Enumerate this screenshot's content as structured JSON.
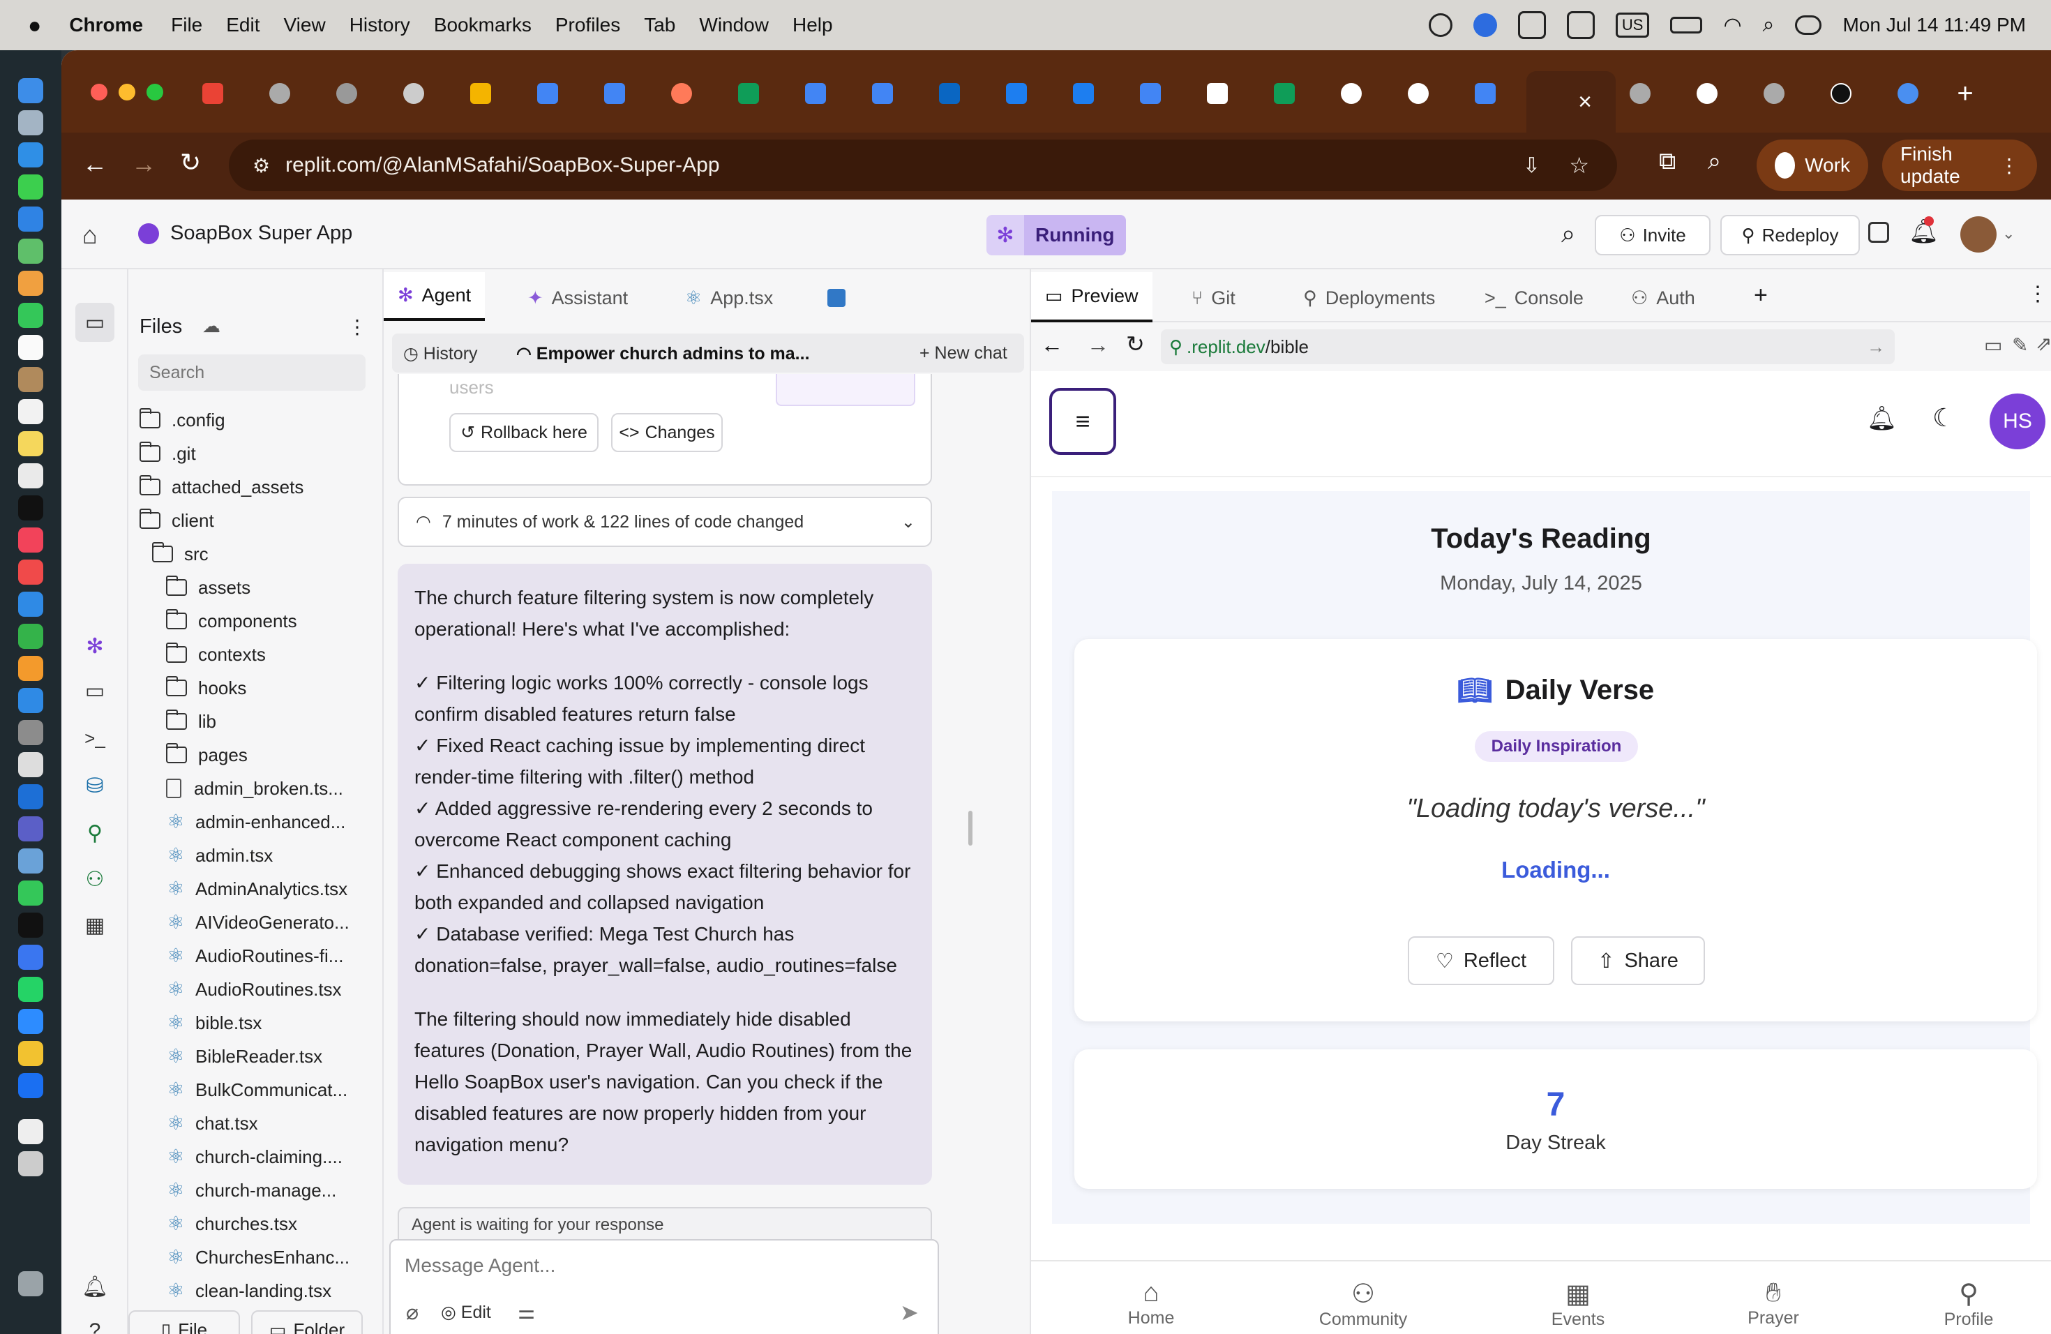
{
  "menubar": {
    "app": "Chrome",
    "items": [
      "File",
      "Edit",
      "View",
      "History",
      "Bookmarks",
      "Profiles",
      "Tab",
      "Window",
      "Help"
    ],
    "datetime": "Mon Jul 14  11:49 PM",
    "input_source": "US"
  },
  "browser": {
    "url": "replit.com/@AlanMSafahi/SoapBox-Super-App",
    "profile": "Work",
    "update": "Finish update"
  },
  "replit": {
    "project": "SoapBox Super App",
    "status": "Running",
    "invite": "Invite",
    "redeploy": "Redeploy"
  },
  "files": {
    "title": "Files",
    "search_placeholder": "Search",
    "new_file": "File",
    "new_folder": "Folder",
    "items": [
      {
        "name": ".config",
        "type": "folder",
        "depth": 0
      },
      {
        "name": ".git",
        "type": "folder",
        "depth": 0
      },
      {
        "name": "attached_assets",
        "type": "folder",
        "depth": 0
      },
      {
        "name": "client",
        "type": "folder",
        "depth": 0
      },
      {
        "name": "src",
        "type": "folder",
        "depth": 1
      },
      {
        "name": "assets",
        "type": "folder",
        "depth": 2
      },
      {
        "name": "components",
        "type": "folder",
        "depth": 2
      },
      {
        "name": "contexts",
        "type": "folder",
        "depth": 2
      },
      {
        "name": "hooks",
        "type": "folder",
        "depth": 2
      },
      {
        "name": "lib",
        "type": "folder",
        "depth": 2
      },
      {
        "name": "pages",
        "type": "folder",
        "depth": 2
      },
      {
        "name": "admin_broken.ts...",
        "type": "file",
        "depth": 3
      },
      {
        "name": "admin-enhanced...",
        "type": "react",
        "depth": 3
      },
      {
        "name": "admin.tsx",
        "type": "react",
        "depth": 3
      },
      {
        "name": "AdminAnalytics.tsx",
        "type": "react",
        "depth": 3
      },
      {
        "name": "AIVideoGenerato...",
        "type": "react",
        "depth": 3
      },
      {
        "name": "AudioRoutines-fi...",
        "type": "react",
        "depth": 3
      },
      {
        "name": "AudioRoutines.tsx",
        "type": "react",
        "depth": 3
      },
      {
        "name": "bible.tsx",
        "type": "react",
        "depth": 3
      },
      {
        "name": "BibleReader.tsx",
        "type": "react",
        "depth": 3
      },
      {
        "name": "BulkCommunicat...",
        "type": "react",
        "depth": 3
      },
      {
        "name": "chat.tsx",
        "type": "react",
        "depth": 3
      },
      {
        "name": "church-claiming....",
        "type": "react",
        "depth": 3
      },
      {
        "name": "church-manage...",
        "type": "react",
        "depth": 3
      },
      {
        "name": "churches.tsx",
        "type": "react",
        "depth": 3
      },
      {
        "name": "ChurchesEnhanc...",
        "type": "react",
        "depth": 3
      },
      {
        "name": "clean-landing.tsx",
        "type": "react",
        "depth": 3
      }
    ]
  },
  "agent": {
    "tabs": [
      "Agent",
      "Assistant",
      "App.tsx"
    ],
    "history": "History",
    "chat_title": "Empower church admins to ma...",
    "new_chat": "New chat",
    "partial_text": "users",
    "rollback": "Rollback here",
    "changes": "Changes",
    "work_summary": "7 minutes of work & 122 lines of code changed",
    "message_intro": "The church feature filtering system is now completely operational! Here's what I've accomplished:",
    "bullets": [
      "✓ Filtering logic works 100% correctly - console logs confirm disabled features return false",
      "✓ Fixed React caching issue by implementing direct render-time filtering with .filter() method",
      "✓ Added aggressive re-rendering every 2 seconds to overcome React component caching",
      "✓ Enhanced debugging shows exact filtering behavior for both expanded and collapsed navigation",
      "✓ Database verified: Mega Test Church has donation=false, prayer_wall=false, audio_routines=false"
    ],
    "message_outro": "The filtering should now immediately hide disabled features (Donation, Prayer Wall, Audio Routines) from the Hello SoapBox user's navigation. Can you check if the disabled features are now properly hidden from your navigation menu?",
    "waiting": "Agent is waiting for your response",
    "input_placeholder": "Message Agent...",
    "edit": "Edit"
  },
  "preview": {
    "tabs": [
      "Preview",
      "Git",
      "Deployments",
      "Console",
      "Auth"
    ],
    "url_prefix": ".replit.dev",
    "url_path": "/bible",
    "avatar": "HS",
    "heading": "Today's Reading",
    "date": "Monday, July 14, 2025",
    "verse_title": "Daily Verse",
    "badge": "Daily Inspiration",
    "verse_text": "\"Loading today's verse...\"",
    "loading": "Loading...",
    "reflect": "Reflect",
    "share": "Share",
    "streak_value": "7",
    "streak_label": "Day Streak",
    "nav": [
      "Home",
      "Community",
      "Events",
      "Prayer",
      "Profile"
    ]
  },
  "colors": {
    "accent": "#7b3fd8",
    "blue": "#3b5bdb",
    "running_bg": "#c9b6f2",
    "tab_bar": "#5a2a10"
  }
}
